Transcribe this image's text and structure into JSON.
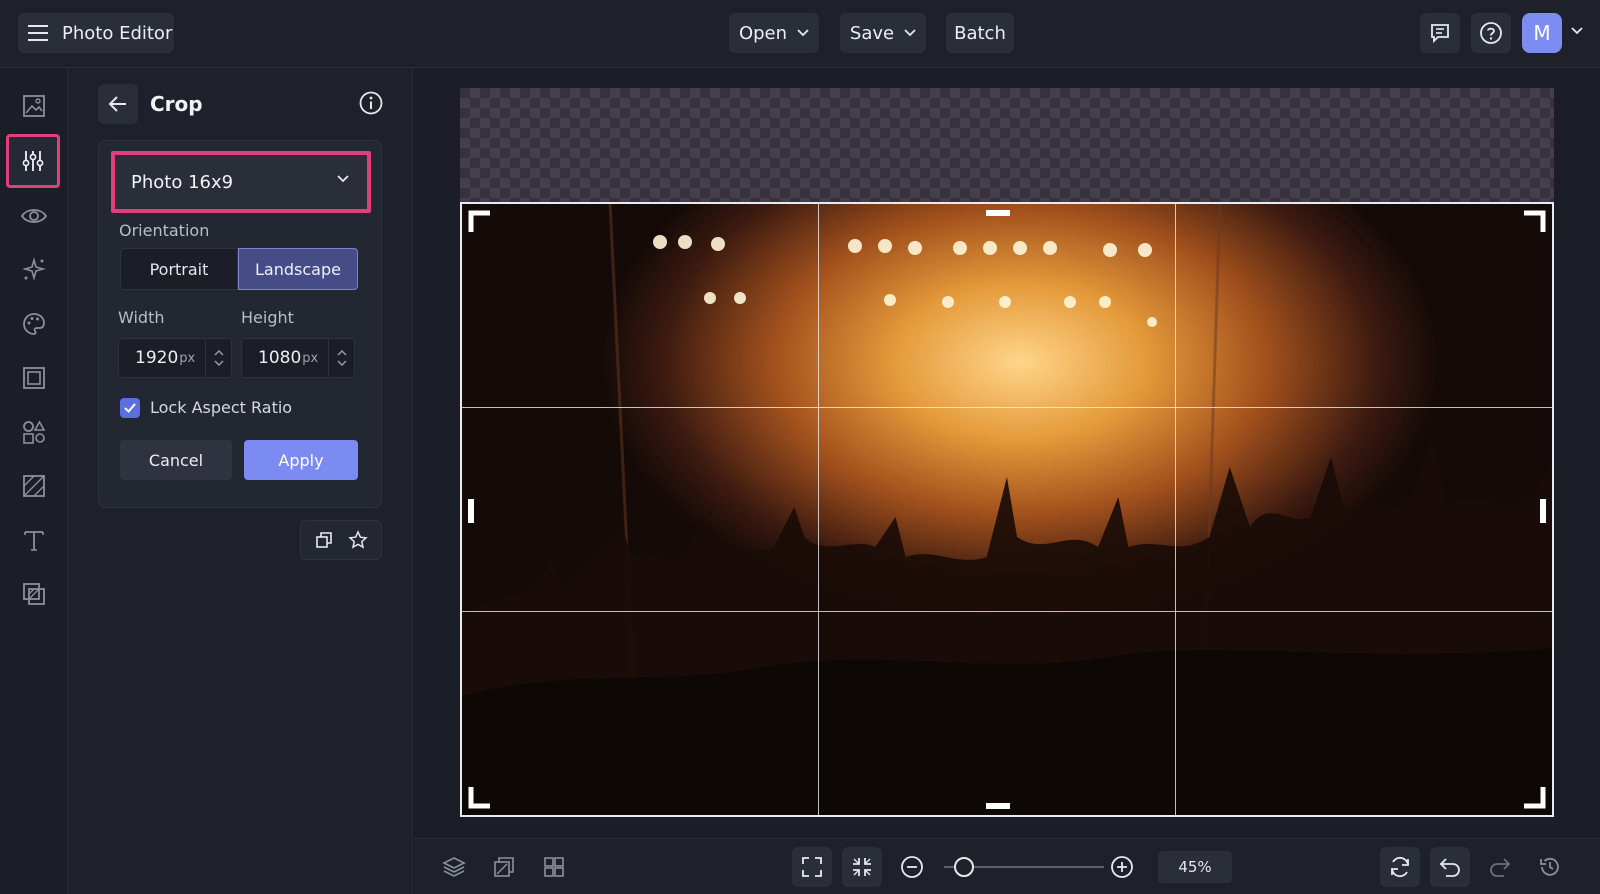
{
  "app": {
    "title": "Photo Editor"
  },
  "menu": {
    "open_label": "Open",
    "save_label": "Save",
    "batch_label": "Batch"
  },
  "user": {
    "initial": "M",
    "avatar_color": "#7c8cf0"
  },
  "rail": {
    "items": [
      {
        "icon": "image-icon",
        "active": false
      },
      {
        "icon": "adjust-sliders-icon",
        "active": true
      },
      {
        "icon": "eye-icon",
        "active": false
      },
      {
        "icon": "sparkle-effects-icon",
        "active": false
      },
      {
        "icon": "palette-icon",
        "active": false
      },
      {
        "icon": "frame-icon",
        "active": false
      },
      {
        "icon": "graphics-icon",
        "active": false
      },
      {
        "icon": "texture-icon",
        "active": false
      },
      {
        "icon": "text-icon",
        "active": false
      },
      {
        "icon": "overlay-icon",
        "active": false
      }
    ]
  },
  "panel": {
    "title": "Crop",
    "preset": {
      "selected": "Photo 16x9"
    },
    "orientation": {
      "label": "Orientation",
      "options": [
        "Portrait",
        "Landscape"
      ],
      "selected": "Landscape"
    },
    "width": {
      "label": "Width",
      "value": "1920",
      "unit": "px"
    },
    "height": {
      "label": "Height",
      "value": "1080",
      "unit": "px"
    },
    "lock_aspect": {
      "label": "Lock Aspect Ratio",
      "checked": true
    },
    "cancel_label": "Cancel",
    "apply_label": "Apply"
  },
  "zoom": {
    "percent_label": "45%",
    "level": 0.05
  },
  "colors": {
    "accent": "#7b8bf2",
    "highlight": "#e0407a",
    "background": "#1b1e26"
  }
}
